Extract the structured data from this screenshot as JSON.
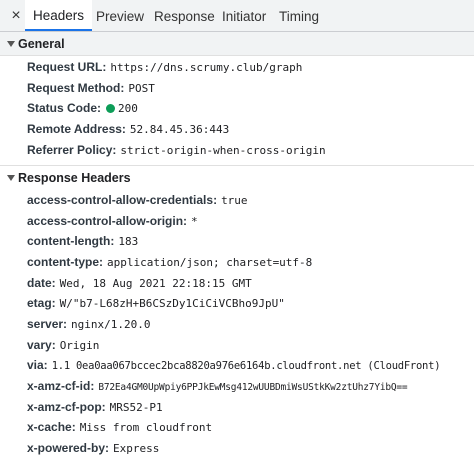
{
  "tabs": {
    "close_glyph": "×",
    "items": [
      {
        "label": "Headers",
        "active": true
      },
      {
        "label": "Preview",
        "active": false
      },
      {
        "label": "Response",
        "active": false
      },
      {
        "label": "Initiator",
        "active": false
      },
      {
        "label": "Timing",
        "active": false
      }
    ]
  },
  "general": {
    "title": "General",
    "rows": [
      {
        "key": "Request URL:",
        "value": "https://dns.scrumy.club/graph"
      },
      {
        "key": "Request Method:",
        "value": "POST"
      },
      {
        "key": "Status Code:",
        "value": "200"
      },
      {
        "key": "Remote Address:",
        "value": "52.84.45.36:443"
      },
      {
        "key": "Referrer Policy:",
        "value": "strict-origin-when-cross-origin"
      }
    ]
  },
  "response_headers": {
    "title": "Response Headers",
    "rows": [
      {
        "key": "access-control-allow-credentials:",
        "value": "true"
      },
      {
        "key": "access-control-allow-origin:",
        "value": "*"
      },
      {
        "key": "content-length:",
        "value": "183"
      },
      {
        "key": "content-type:",
        "value": "application/json; charset=utf-8"
      },
      {
        "key": "date:",
        "value": "Wed, 18 Aug 2021 22:18:15 GMT"
      },
      {
        "key": "etag:",
        "value": "W/\"b7-L68zH+B6CSzDy1CiCiVCBho9JpU\""
      },
      {
        "key": "server:",
        "value": "nginx/1.20.0"
      },
      {
        "key": "vary:",
        "value": "Origin"
      },
      {
        "key": "via:",
        "value": "1.1 0ea0aa067bccec2bca8820a976e6164b.cloudfront.net (CloudFront)"
      },
      {
        "key": "x-amz-cf-id:",
        "value": "B72Ea4GM0UpWpiy6PPJkEwMsg412wUUBDmiWsUStkKw2ztUhz7YibQ=="
      },
      {
        "key": "x-amz-cf-pop:",
        "value": "MRS52-P1"
      },
      {
        "key": "x-cache:",
        "value": "Miss from cloudfront"
      },
      {
        "key": "x-powered-by:",
        "value": "Express"
      }
    ]
  },
  "colors": {
    "status_ok": "#0d9d58",
    "active_tab_underline": "#1a73e8"
  }
}
